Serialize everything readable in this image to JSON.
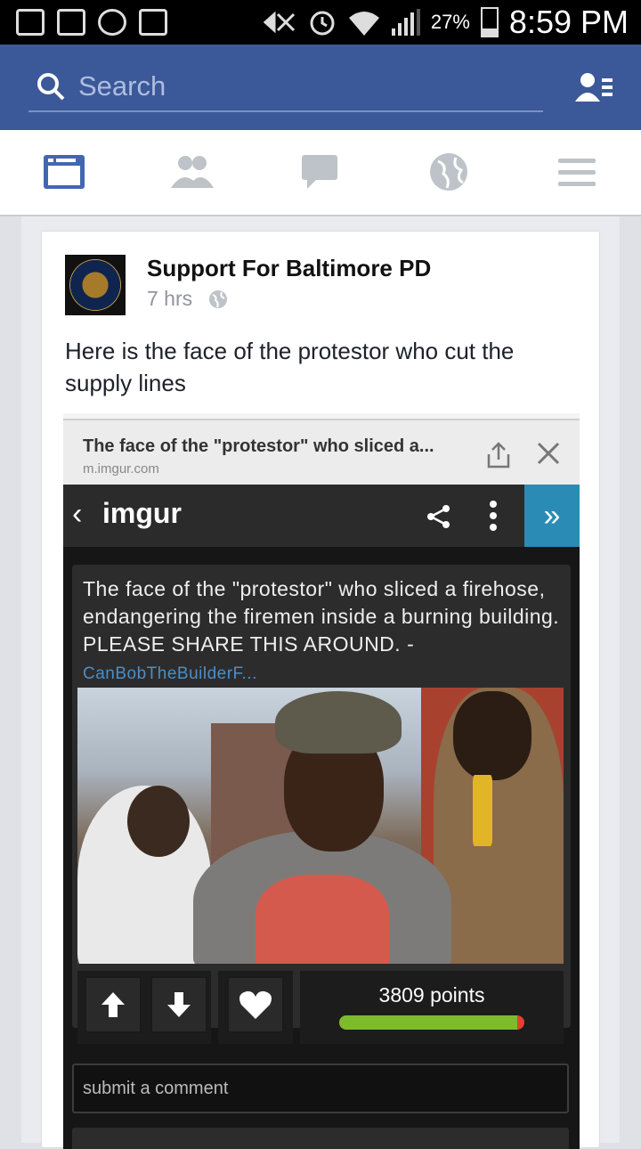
{
  "status_bar": {
    "battery": "27%",
    "time": "8:59 PM",
    "left_icons": [
      "gallery-icon",
      "gmail-icon",
      "sync-icon",
      "clipboard-icon"
    ],
    "right_icons": [
      "mute-icon",
      "alarm-icon",
      "wifi-icon",
      "signal-icon",
      "battery-icon"
    ]
  },
  "header": {
    "search_placeholder": "Search",
    "background_color": "#3b5998"
  },
  "nav": {
    "tabs": [
      "news-feed-icon",
      "friends-icon",
      "messages-icon",
      "globe-icon",
      "menu-icon"
    ],
    "active_tab": "news-feed-icon"
  },
  "post": {
    "author": "Support For Baltimore PD",
    "time": "7 hrs",
    "privacy_icon": "globe-icon",
    "text": "Here is the face of the protestor who cut the supply lines",
    "screenshot": {
      "page_title": "The face of the \"protestor\" who sliced a...",
      "page_url": "m.imgur.com",
      "site_logo": "imgur",
      "caption": "The face of the \"protestor\" who sliced a firehose, endangering the firemen inside a burning building. PLEASE SHARE THIS AROUND. - ",
      "caption_author": "CanBobTheBuilderF...",
      "points": "3809 points",
      "upvote_ratio": 0.96,
      "comment_placeholder": "submit a comment",
      "accent_color": "#2a8cb4"
    }
  }
}
